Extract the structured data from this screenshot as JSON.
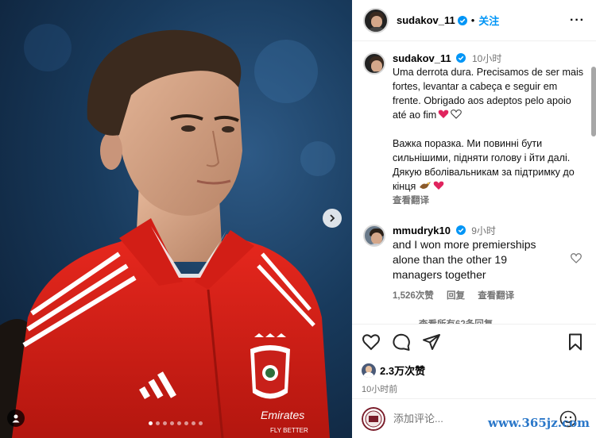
{
  "post": {
    "username": "sudakov_11",
    "follow_label": "关注",
    "separator": "•",
    "caption_time": "10小时",
    "caption_pt": "Uma derrota dura. Precisamos de ser mais fortes, levantar a cabeça e seguir em frente. Obrigado aos adeptos pelo apoio até ao fim",
    "caption_uk": "Важка поразка. Ми повинні бути сильнішими, підняти голову і йти далі. Дякую вболівальникам за підтримку до кінця",
    "see_translation": "查看翻译",
    "image_dots": 8,
    "active_dot": 0
  },
  "comment": {
    "username": "mmudryk10",
    "time": "9小时",
    "text": "and I won more premierships alone than the other 19 managers together",
    "likes": "1,526次赞",
    "reply": "回复",
    "see_translation": "查看翻译",
    "view_all": "查看所有62条回复"
  },
  "footer": {
    "likes": "2.3万次赞",
    "posted": "10小时前",
    "add_comment_placeholder": "添加评论..."
  },
  "photo": {
    "jersey_sponsor": "Emirates",
    "jersey_sponsor_sub": "FLY BETTER"
  },
  "colors": {
    "accent": "#0095f6",
    "heart": "#ed4956",
    "jersey": "#e2231a"
  },
  "icons": [
    "heart-icon",
    "comment-icon",
    "share-icon",
    "bookmark-icon",
    "more-icon",
    "verified-icon",
    "chevron-right-icon",
    "emoji-icon",
    "user-tag-icon"
  ],
  "watermark": "www.365jz.com"
}
